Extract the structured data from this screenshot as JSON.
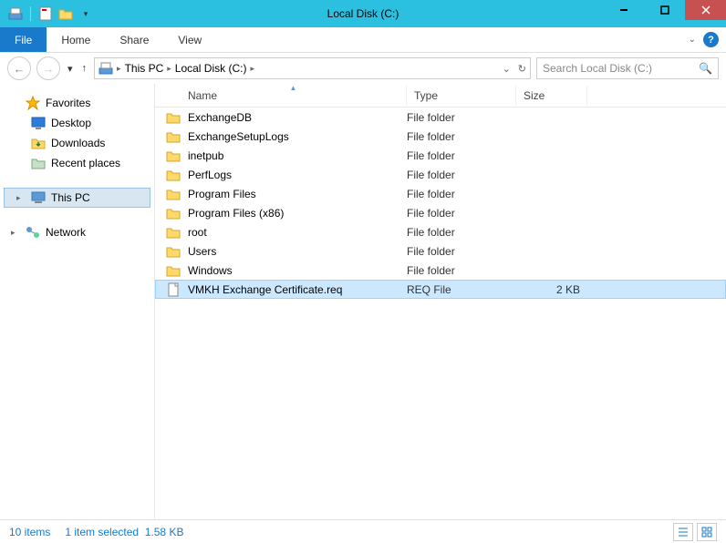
{
  "titlebar": {
    "title": "Local Disk (C:)"
  },
  "ribbon": {
    "file": "File",
    "tabs": [
      "Home",
      "Share",
      "View"
    ]
  },
  "address": {
    "crumbs": [
      "This PC",
      "Local Disk (C:)"
    ],
    "search_placeholder": "Search Local Disk (C:)"
  },
  "navpane": {
    "favorites": {
      "label": "Favorites",
      "items": [
        {
          "icon": "desktop",
          "label": "Desktop"
        },
        {
          "icon": "downloads",
          "label": "Downloads"
        },
        {
          "icon": "recent",
          "label": "Recent places"
        }
      ]
    },
    "thispc": {
      "label": "This PC"
    },
    "network": {
      "label": "Network"
    }
  },
  "columns": {
    "name": "Name",
    "type": "Type",
    "size": "Size"
  },
  "files": [
    {
      "name": "ExchangeDB",
      "type": "File folder",
      "size": "",
      "kind": "folder",
      "selected": false
    },
    {
      "name": "ExchangeSetupLogs",
      "type": "File folder",
      "size": "",
      "kind": "folder",
      "selected": false
    },
    {
      "name": "inetpub",
      "type": "File folder",
      "size": "",
      "kind": "folder",
      "selected": false
    },
    {
      "name": "PerfLogs",
      "type": "File folder",
      "size": "",
      "kind": "folder",
      "selected": false
    },
    {
      "name": "Program Files",
      "type": "File folder",
      "size": "",
      "kind": "folder",
      "selected": false
    },
    {
      "name": "Program Files (x86)",
      "type": "File folder",
      "size": "",
      "kind": "folder",
      "selected": false
    },
    {
      "name": "root",
      "type": "File folder",
      "size": "",
      "kind": "folder",
      "selected": false
    },
    {
      "name": "Users",
      "type": "File folder",
      "size": "",
      "kind": "folder",
      "selected": false
    },
    {
      "name": "Windows",
      "type": "File folder",
      "size": "",
      "kind": "folder",
      "selected": false
    },
    {
      "name": "VMKH Exchange Certificate.req",
      "type": "REQ File",
      "size": "2 KB",
      "kind": "file",
      "selected": true
    }
  ],
  "statusbar": {
    "count": "10 items",
    "selection": "1 item selected",
    "selsize": "1.58 KB"
  }
}
